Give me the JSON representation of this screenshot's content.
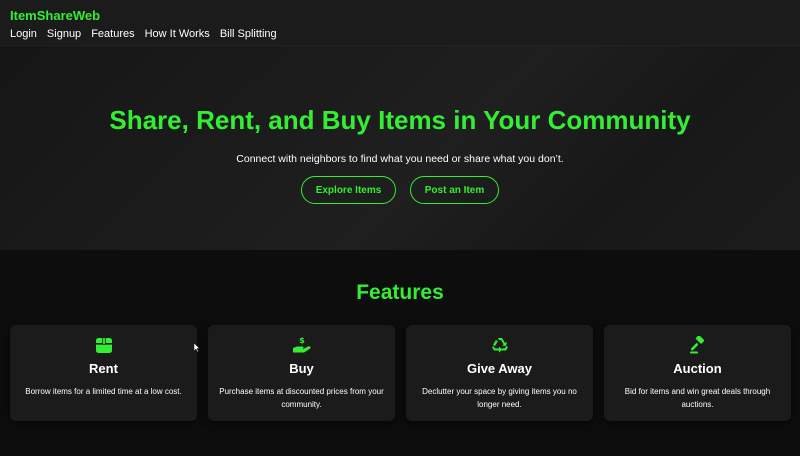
{
  "brand": "ItemShareWeb",
  "nav": {
    "items": [
      "Login",
      "Signup",
      "Features",
      "How It Works",
      "Bill Splitting"
    ]
  },
  "hero": {
    "title": "Share, Rent, and Buy Items in Your Community",
    "subtitle": "Connect with neighbors to find what you need or share what you don’t.",
    "explore_label": "Explore Items",
    "post_label": "Post an Item"
  },
  "features": {
    "title": "Features",
    "cards": [
      {
        "icon": "box-icon",
        "title": "Rent",
        "desc": "Borrow items for a limited time at a low cost."
      },
      {
        "icon": "hand-dollar-icon",
        "title": "Buy",
        "desc": "Purchase items at discounted prices from your community."
      },
      {
        "icon": "recycle-icon",
        "title": "Give Away",
        "desc": "Declutter your space by giving items you no longer need."
      },
      {
        "icon": "gavel-icon",
        "title": "Auction",
        "desc": "Bid for items and win great deals through auctions."
      }
    ]
  },
  "colors": {
    "accent": "#33ee33",
    "background": "#0d0d0d",
    "surface": "#1b1b1b"
  }
}
